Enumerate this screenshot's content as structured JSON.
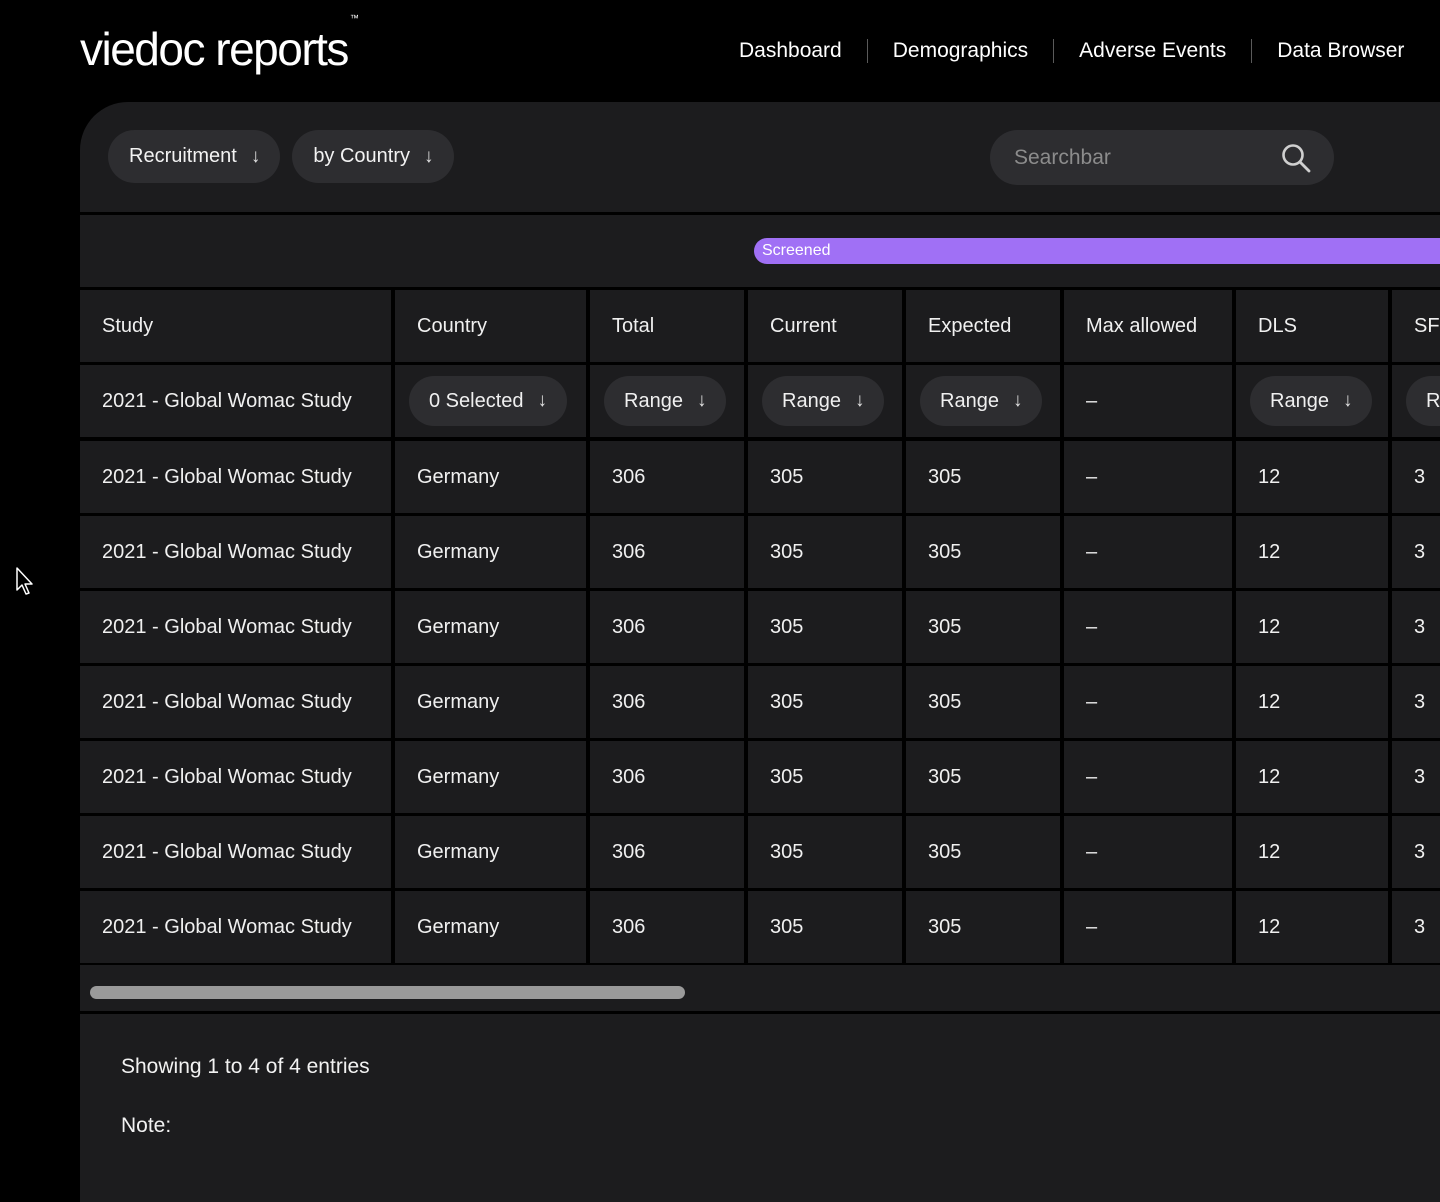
{
  "header": {
    "logo": "viedoc reports",
    "logo_tm": "™",
    "nav": [
      "Dashboard",
      "Demographics",
      "Adverse Events",
      "Data Browser"
    ]
  },
  "filters": {
    "report": "Recruitment",
    "group": "by Country",
    "arrow": "↓"
  },
  "search": {
    "placeholder": "Searchbar",
    "icon": "search-icon"
  },
  "group_bar": {
    "label": "Screened",
    "color": "#a070f5"
  },
  "table": {
    "columns": [
      "Study",
      "Country",
      "Total",
      "Current",
      "Expected",
      "Max allowed",
      "DLS",
      "SF"
    ],
    "filter_row": {
      "study": "2021 - Global Womac Study",
      "country": "0 Selected",
      "total": "Range",
      "current": "Range",
      "expected": "Range",
      "max_allowed": "–",
      "dls": "Range",
      "sf": "Range"
    },
    "rows": [
      [
        "2021 - Global Womac Study",
        "Germany",
        "306",
        "305",
        "305",
        "–",
        "12",
        "3"
      ],
      [
        "2021 - Global Womac Study",
        "Germany",
        "306",
        "305",
        "305",
        "–",
        "12",
        "3"
      ],
      [
        "2021 - Global Womac Study",
        "Germany",
        "306",
        "305",
        "305",
        "–",
        "12",
        "3"
      ],
      [
        "2021 - Global Womac Study",
        "Germany",
        "306",
        "305",
        "305",
        "–",
        "12",
        "3"
      ],
      [
        "2021 - Global Womac Study",
        "Germany",
        "306",
        "305",
        "305",
        "–",
        "12",
        "3"
      ],
      [
        "2021 - Global Womac Study",
        "Germany",
        "306",
        "305",
        "305",
        "–",
        "12",
        "3"
      ],
      [
        "2021 - Global Womac Study",
        "Germany",
        "306",
        "305",
        "305",
        "–",
        "12",
        "3"
      ]
    ]
  },
  "footer": {
    "entries": "Showing 1 to 4 of 4 entries",
    "note": "Note:"
  },
  "colors": {
    "background": "#000000",
    "panel": "#1c1c1e",
    "pill": "#2d2d30",
    "accent": "#a070f5"
  }
}
